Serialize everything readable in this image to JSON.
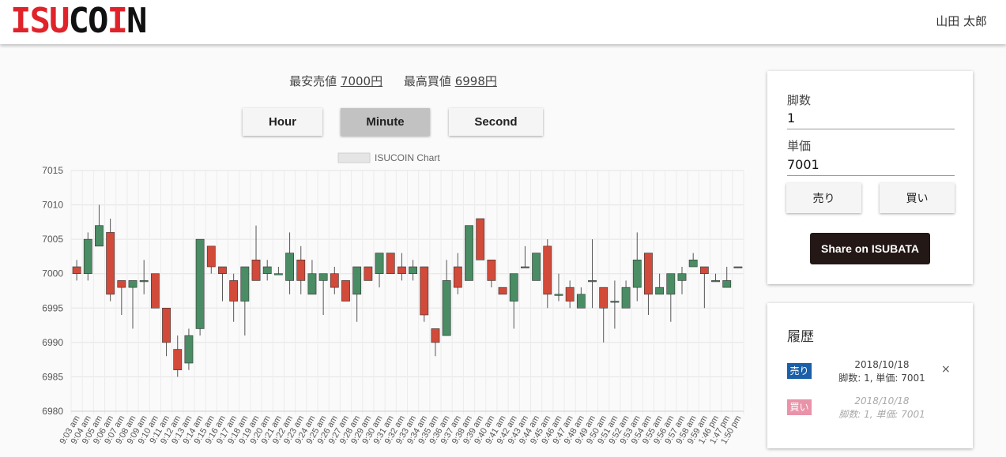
{
  "header": {
    "logo_red": "ISU",
    "logo_black": "COIN",
    "logo_red2": "I",
    "logo_black2": "N",
    "user_name": "山田 太郎"
  },
  "prices": {
    "lowest_sell_label": "最安売値",
    "lowest_sell_value": "7000円",
    "highest_buy_label": "最高買値",
    "highest_buy_value": "6998円"
  },
  "tabs": [
    {
      "label": "Hour"
    },
    {
      "label": "Minute"
    },
    {
      "label": "Second"
    }
  ],
  "colors": {
    "up": "#4a8c64",
    "down": "#d14a3a",
    "sell_badge": "#1b5fa8",
    "buy_badge": "#e993a8",
    "share_bg": "#231815"
  },
  "chart_data": {
    "type": "candlestick",
    "legend": "ISUCOIN Chart",
    "ylim": [
      6980,
      7015
    ],
    "yticks": [
      6980,
      6985,
      6990,
      6995,
      7000,
      7005,
      7010,
      7015
    ],
    "grid": true,
    "x": [
      "9:03 am",
      "9:04 am",
      "9:05 am",
      "9:06 am",
      "9:07 am",
      "9:08 am",
      "9:09 am",
      "9:10 am",
      "9:11 am",
      "9:12 am",
      "9:13 am",
      "9:14 am",
      "9:15 am",
      "9:16 am",
      "9:17 am",
      "9:18 am",
      "9:19 am",
      "9:20 am",
      "9:21 am",
      "9:22 am",
      "9:23 am",
      "9:24 am",
      "9:25 am",
      "9:26 am",
      "9:27 am",
      "9:28 am",
      "9:29 am",
      "9:30 am",
      "9:31 am",
      "9:32 am",
      "9:33 am",
      "9:34 am",
      "9:35 am",
      "9:36 am",
      "9:37 am",
      "9:38 am",
      "9:39 am",
      "9:40 am",
      "9:41 am",
      "9:42 am",
      "9:43 am",
      "9:44 am",
      "9:45 am",
      "9:46 am",
      "9:47 am",
      "9:48 am",
      "9:49 am",
      "9:50 am",
      "9:51 am",
      "9:52 am",
      "9:53 am",
      "9:54 am",
      "9:55 am",
      "9:56 am",
      "9:57 am",
      "9:58 am",
      "9:59 am",
      "1:46 pm",
      "1:47 pm",
      "1:50 pm"
    ],
    "candles": [
      {
        "o": 7001,
        "c": 7000,
        "h": 7002,
        "l": 6999
      },
      {
        "o": 7000,
        "c": 7005,
        "h": 7006,
        "l": 6999
      },
      {
        "o": 7004,
        "c": 7007,
        "h": 7010,
        "l": 7004
      },
      {
        "o": 7006,
        "c": 6997,
        "h": 7008,
        "l": 6996
      },
      {
        "o": 6999,
        "c": 6998,
        "h": 6999,
        "l": 6994
      },
      {
        "o": 6998,
        "c": 6999,
        "h": 6999,
        "l": 6992
      },
      {
        "o": 6999,
        "c": 6999,
        "h": 7002,
        "l": 6997
      },
      {
        "o": 7000,
        "c": 6995,
        "h": 7000,
        "l": 6995
      },
      {
        "o": 6995,
        "c": 6990,
        "h": 6995,
        "l": 6988
      },
      {
        "o": 6989,
        "c": 6986,
        "h": 6991,
        "l": 6985
      },
      {
        "o": 6987,
        "c": 6991,
        "h": 6992,
        "l": 6986
      },
      {
        "o": 6992,
        "c": 7005,
        "h": 7005,
        "l": 6991
      },
      {
        "o": 7004,
        "c": 7001,
        "h": 7004,
        "l": 7000
      },
      {
        "o": 7001,
        "c": 7000,
        "h": 7001,
        "l": 6996
      },
      {
        "o": 6999,
        "c": 6996,
        "h": 7000,
        "l": 6993
      },
      {
        "o": 6996,
        "c": 7001,
        "h": 7001,
        "l": 6991
      },
      {
        "o": 7002,
        "c": 6999,
        "h": 7007,
        "l": 6999
      },
      {
        "o": 7000,
        "c": 7001,
        "h": 7002,
        "l": 6999
      },
      {
        "o": 7000,
        "c": 7000,
        "h": 7001,
        "l": 7000
      },
      {
        "o": 6999,
        "c": 7003,
        "h": 7006,
        "l": 6997
      },
      {
        "o": 7002,
        "c": 6999,
        "h": 7004,
        "l": 6997
      },
      {
        "o": 6997,
        "c": 7000,
        "h": 7002,
        "l": 6997
      },
      {
        "o": 6999,
        "c": 7000,
        "h": 7000,
        "l": 6994
      },
      {
        "o": 7000,
        "c": 6998,
        "h": 7001,
        "l": 6997
      },
      {
        "o": 6999,
        "c": 6996,
        "h": 6999,
        "l": 6996
      },
      {
        "o": 6997,
        "c": 7001,
        "h": 7001,
        "l": 6993
      },
      {
        "o": 7001,
        "c": 6999,
        "h": 7001,
        "l": 6999
      },
      {
        "o": 7000,
        "c": 7003,
        "h": 7003,
        "l": 6998
      },
      {
        "o": 7003,
        "c": 7000,
        "h": 7003,
        "l": 7000
      },
      {
        "o": 7001,
        "c": 7000,
        "h": 7003,
        "l": 6999
      },
      {
        "o": 7000,
        "c": 7001,
        "h": 7002,
        "l": 6999
      },
      {
        "o": 7001,
        "c": 6994,
        "h": 7001,
        "l": 6993
      },
      {
        "o": 6992,
        "c": 6990,
        "h": 6992,
        "l": 6988
      },
      {
        "o": 6991,
        "c": 6999,
        "h": 7002,
        "l": 6991
      },
      {
        "o": 7001,
        "c": 6998,
        "h": 7003,
        "l": 6997
      },
      {
        "o": 6999,
        "c": 7007,
        "h": 7007,
        "l": 6999
      },
      {
        "o": 7008,
        "c": 7002,
        "h": 7008,
        "l": 7002
      },
      {
        "o": 7002,
        "c": 6999,
        "h": 7002,
        "l": 6998
      },
      {
        "o": 6998,
        "c": 6997,
        "h": 6998,
        "l": 6997
      },
      {
        "o": 6996,
        "c": 7000,
        "h": 7000,
        "l": 6992
      },
      {
        "o": 7001,
        "c": 7001,
        "h": 7004,
        "l": 7001
      },
      {
        "o": 6999,
        "c": 7003,
        "h": 7003,
        "l": 6999
      },
      {
        "o": 7004,
        "c": 6997,
        "h": 7005,
        "l": 6995
      },
      {
        "o": 6997,
        "c": 6997,
        "h": 7000,
        "l": 6996
      },
      {
        "o": 6998,
        "c": 6996,
        "h": 6999,
        "l": 6995
      },
      {
        "o": 6995,
        "c": 6997,
        "h": 6998,
        "l": 6995
      },
      {
        "o": 6999,
        "c": 6999,
        "h": 7005,
        "l": 6995
      },
      {
        "o": 6998,
        "c": 6995,
        "h": 6998,
        "l": 6990
      },
      {
        "o": 6996,
        "c": 6996,
        "h": 6999,
        "l": 6992
      },
      {
        "o": 6995,
        "c": 6998,
        "h": 6999,
        "l": 6995
      },
      {
        "o": 6998,
        "c": 7002,
        "h": 7006,
        "l": 6996
      },
      {
        "o": 7003,
        "c": 6997,
        "h": 7003,
        "l": 6994
      },
      {
        "o": 6997,
        "c": 6998,
        "h": 7000,
        "l": 6997
      },
      {
        "o": 6997,
        "c": 7000,
        "h": 7000,
        "l": 6993
      },
      {
        "o": 6999,
        "c": 7000,
        "h": 7001,
        "l": 6997
      },
      {
        "o": 7001,
        "c": 7002,
        "h": 7003,
        "l": 7001
      },
      {
        "o": 7001,
        "c": 7000,
        "h": 7001,
        "l": 6995
      },
      {
        "o": 6999,
        "c": 6999,
        "h": 7000,
        "l": 6999
      },
      {
        "o": 6998,
        "c": 6999,
        "h": 7001,
        "l": 6998
      },
      {
        "o": 7001,
        "c": 7001,
        "h": 7001,
        "l": 7001
      }
    ]
  },
  "order": {
    "qty_label": "脚数",
    "qty_value": "1",
    "price_label": "単価",
    "price_value": "7001",
    "sell_label": "売り",
    "buy_label": "買い",
    "share_label": "Share on ISUBATA"
  },
  "history": {
    "title": "履歴",
    "items": [
      {
        "type": "売り",
        "date": "2018/10/18",
        "detail": "脚数: 1, 単価: 7001",
        "close": "×"
      },
      {
        "type": "買い",
        "date": "2018/10/18",
        "detail": "脚数: 1, 単価: 7001"
      }
    ]
  }
}
